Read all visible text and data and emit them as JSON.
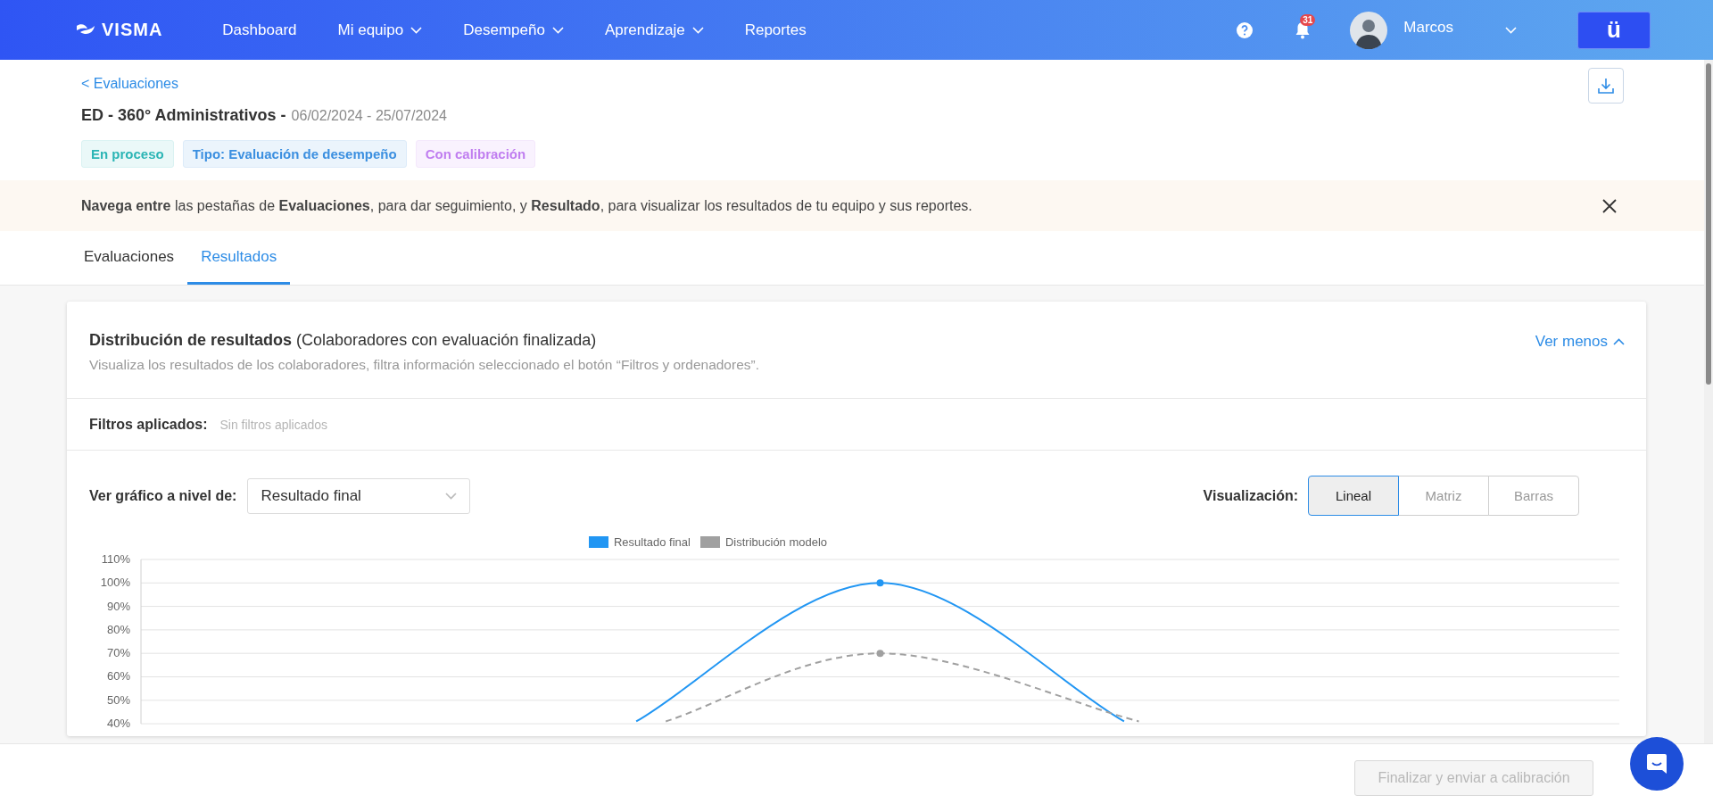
{
  "nav": {
    "logo": "VISMA",
    "items": [
      {
        "label": "Dashboard",
        "dropdown": false
      },
      {
        "label": "Mi equipo",
        "dropdown": true
      },
      {
        "label": "Desempeño",
        "dropdown": true
      },
      {
        "label": "Aprendizaje",
        "dropdown": true
      },
      {
        "label": "Reportes",
        "dropdown": false
      }
    ],
    "notifications": "31",
    "user": "Marcos",
    "app_button": "ü"
  },
  "header": {
    "back": "< Evaluaciones",
    "title": "ED - 360° Administrativos -",
    "dates": "06/02/2024 - 25/07/2024",
    "tags": [
      {
        "label": "En proceso",
        "color": "#2bb5b5"
      },
      {
        "label": "Tipo: Evaluación de desempeño",
        "color": "#3b8fe0"
      },
      {
        "label": "Con calibración",
        "color": "#c07ef0"
      }
    ]
  },
  "notice": "**Navega entre** las pestañas de **Evaluaciones**, para dar seguimiento, y **Resultado**, para visualizar los resultados de tu equipo y sus reportes.",
  "tabs": [
    {
      "label": "Evaluaciones",
      "selected": false
    },
    {
      "label": "Resultados",
      "selected": true
    }
  ],
  "card": {
    "title": "Distribución de resultados",
    "title_note": "(Colaboradores con evaluación finalizada)",
    "subtitle": "Visualiza los resultados de los colaboradores, filtra información seleccionado el botón “Filtros y ordenadores”.",
    "toggle": "Ver menos",
    "filters": {
      "label": "Filtros aplicados:",
      "value": "Sin filtros aplicados"
    },
    "level_select": {
      "label": "Ver gráfico a nivel de:",
      "value": "Resultado final"
    },
    "visualization": {
      "label": "Visualización:",
      "options": [
        {
          "label": "Lineal",
          "selected": true
        },
        {
          "label": "Matriz",
          "selected": false
        },
        {
          "label": "Barras",
          "selected": false
        }
      ]
    },
    "chart": {
      "y_labels": [
        "110%",
        "100%",
        "90%",
        "80%",
        "70%",
        "60%",
        "50%",
        "40%"
      ],
      "legend": [
        {
          "label": "Resultado final",
          "color": "#2196f3",
          "dashed": false
        },
        {
          "label": "Distribución modelo",
          "color": "#a0a0a0",
          "dashed": true
        }
      ]
    }
  },
  "footer": {
    "button": "Finalizar y enviar a calibración",
    "disabled": true
  }
}
